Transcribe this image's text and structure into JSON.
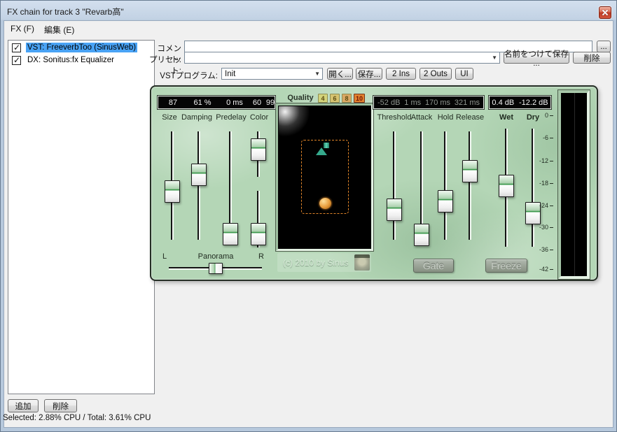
{
  "window": {
    "title": "FX chain for track 3 \"Revarb高\""
  },
  "menu": {
    "fx": "FX (F)",
    "edit": "編集 (E)"
  },
  "fx_list": {
    "items": [
      {
        "label": "VST: FreeverbToo (SinusWeb)",
        "checked": true,
        "selected": true
      },
      {
        "label": "DX: Sonitus:fx Equalizer",
        "checked": true,
        "selected": false
      }
    ],
    "add": "追加",
    "remove": "削除",
    "status": "Selected: 2.88% CPU / Total: 3.61% CPU"
  },
  "controls": {
    "comment_label": "コメント:",
    "comment_value": "",
    "more": "...",
    "preset_label": "プリセット:",
    "preset_value": "",
    "save_as": "名前をつけて保存 ...",
    "preset_delete": "削除",
    "program_label": "VSTプログラム:",
    "program_value": "Init",
    "open": "開く...",
    "save": "保存...",
    "ins": "2 Ins",
    "outs": "2 Outs",
    "ui": "UI"
  },
  "plugin": {
    "left_display": {
      "size": "87",
      "damping": "61 %",
      "predelay": "0 ms",
      "color_a": "60",
      "color_b": "99"
    },
    "left_labels": [
      "Size",
      "Damping",
      "Predelay",
      "Color"
    ],
    "quality": {
      "label": "Quality",
      "options": [
        "4",
        "6",
        "8",
        "10"
      ],
      "selected": "10"
    },
    "copyright": "(c) 2010 by Sinus",
    "pan": {
      "l": "L",
      "label": "Panorama",
      "r": "R"
    },
    "gate_display": [
      "-52 dB",
      "1 ms",
      "170 ms",
      "321 ms"
    ],
    "gate_labels": [
      "Threshold",
      "Attack",
      "Hold",
      "Release"
    ],
    "mix_display": [
      "0.4 dB",
      "-12.2 dB"
    ],
    "mix_labels": [
      "Wet",
      "Dry"
    ],
    "gate": "Gate",
    "freeze": "Freeze",
    "meter_scale": [
      "0",
      "-6",
      "-12",
      "-18",
      "-24",
      "-30",
      "-36",
      "-42"
    ]
  },
  "slider_positions": {
    "size": 0.555,
    "damping": 0.4,
    "predelay": 0.948,
    "color_top": 0.4,
    "color_bottom": 0.765,
    "threshold": 0.72,
    "attack": 0.955,
    "hold": 0.645,
    "release": 0.368,
    "wet": 0.485,
    "dry": 0.716,
    "pan": 0.5
  },
  "colors": {
    "plugin_green": "#b4d6b6",
    "selection_blue": "#49a3f5",
    "quality_selected": "#e2812f",
    "accent_orange": "#e08428"
  }
}
